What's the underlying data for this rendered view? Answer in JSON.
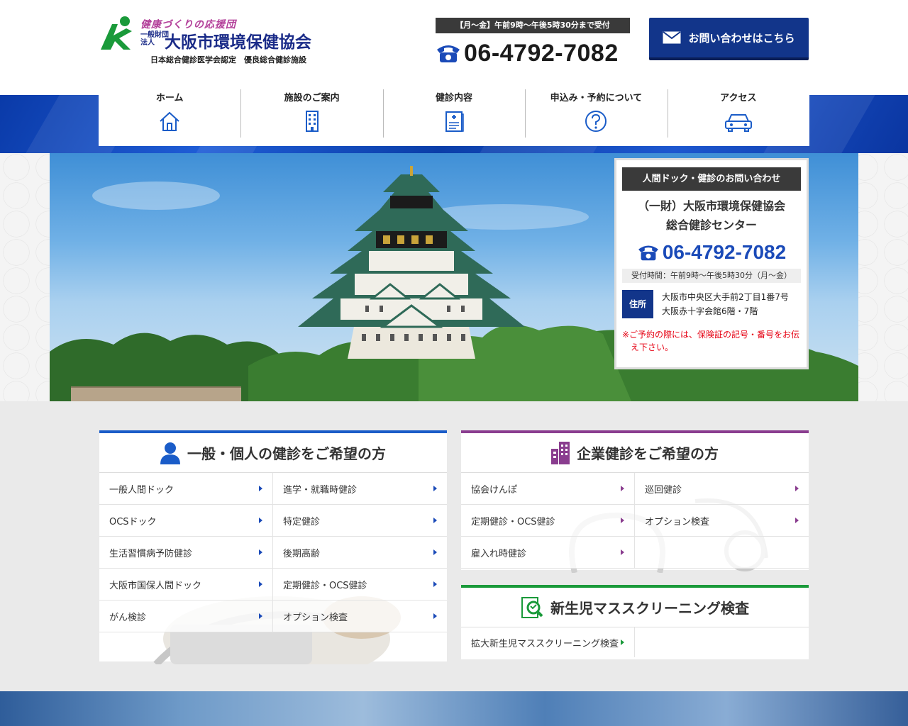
{
  "header": {
    "tagline": "健康づくりの応援団",
    "corp_type": "一般財団法人",
    "org_name": "大阪市環境保健協会",
    "certification": "日本総合健診医学会認定　優良総合健診施設",
    "hours_badge": "【月～金】午前9時～午後5時30分まで受付",
    "phone": "06-4792-7082",
    "contact_button": "お問い合わせはこちら"
  },
  "nav": {
    "items": [
      {
        "label": "ホーム",
        "icon": "home-icon"
      },
      {
        "label": "施設のご案内",
        "icon": "building-icon"
      },
      {
        "label": "健診内容",
        "icon": "clipboard-icon"
      },
      {
        "label": "申込み・予約について",
        "icon": "question-icon"
      },
      {
        "label": "アクセス",
        "icon": "car-icon"
      }
    ]
  },
  "info_box": {
    "title": "人間ドック・健診のお問い合わせ",
    "org_line1": "（一財）大阪市環境保健協会",
    "org_line2": "総合健診センター",
    "phone": "06-4792-7082",
    "hours": "受付時間：午前9時～午後5時30分（月～金）",
    "address_tag": "住所",
    "address_line1": "大阪市中央区大手前2丁目1番7号",
    "address_line2": "大阪赤十字会館6階・7階",
    "note": "※ご予約の際には、保険証の記号・番号をお伝え下さい。"
  },
  "panels": {
    "individual": {
      "title": "一般・個人の健診をご希望の方",
      "accent": "#1a5cc8",
      "items": [
        "一般人間ドック",
        "進学・就職時健診",
        "OCSドック",
        "特定健診",
        "生活習慣病予防健診",
        "後期高齢",
        "大阪市国保人間ドック",
        "定期健診・OCS健診",
        "がん検診",
        "オプション検査"
      ]
    },
    "corporate": {
      "title": "企業健診をご希望の方",
      "accent": "#8a3d8f",
      "items": [
        "協会けんぽ",
        "巡回健診",
        "定期健診・OCS健診",
        "オプション検査",
        "雇入れ時健診"
      ]
    },
    "newborn": {
      "title": "新生児マススクリーニング検査",
      "accent": "#1a9a3a",
      "items": [
        "拡大新生児マススクリーニング検査"
      ]
    }
  }
}
